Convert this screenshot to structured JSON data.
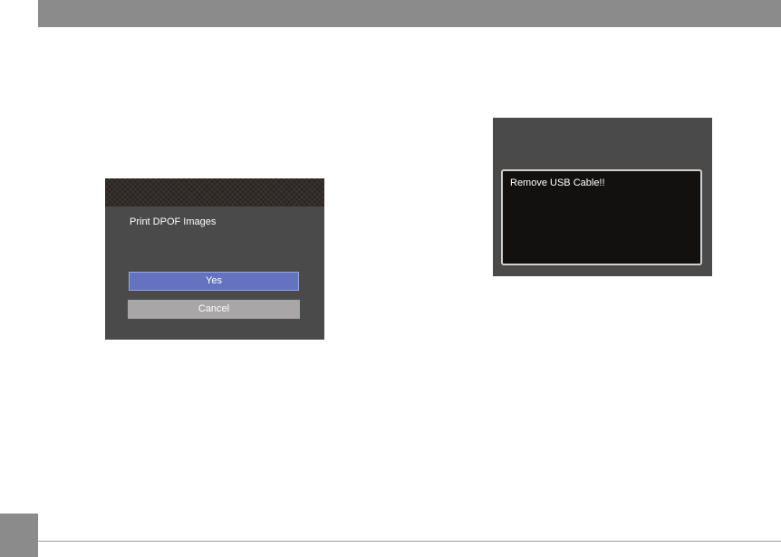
{
  "left_screen": {
    "prompt": "Print DPOF Images",
    "buttons": {
      "yes_label": "Yes",
      "cancel_label": "Cancel"
    },
    "selected_button": "Yes"
  },
  "right_screen": {
    "message": "Remove USB Cable!!"
  },
  "colors": {
    "page_band": "#8b8b8b",
    "screen_bg": "#4b4a4b",
    "title_bar": "#2e2724",
    "yes_highlight": "#6473c0",
    "cancel_bg": "#a8a6a6",
    "message_bg": "#131110",
    "message_border": "#d0d0d0"
  }
}
